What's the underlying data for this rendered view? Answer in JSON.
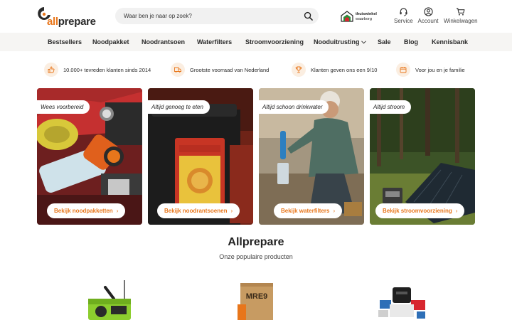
{
  "brand": {
    "name_prefix": "all",
    "name_suffix": "prepare",
    "accent": "#e8761b",
    "logo_icon": "allprepare-logo-icon"
  },
  "search": {
    "placeholder": "Waar ben je naar op zoek?",
    "icon": "search-icon"
  },
  "trust_badge": {
    "line1": "thuiswinkel",
    "line2": "waarborg",
    "icon": "thuiswinkel-house-icon"
  },
  "header_actions": [
    {
      "label": "Service",
      "icon": "headset-icon"
    },
    {
      "label": "Account",
      "icon": "user-icon"
    },
    {
      "label": "Winkelwagen",
      "icon": "cart-icon"
    }
  ],
  "nav": [
    {
      "label": "Bestsellers"
    },
    {
      "label": "Noodpakket"
    },
    {
      "label": "Noodrantsoen"
    },
    {
      "label": "Waterfilters"
    },
    {
      "label": "Stroomvoorziening"
    },
    {
      "label": "Nooduitrusting",
      "has_dropdown": true,
      "icon": "chevron-down-icon"
    },
    {
      "label": "Sale"
    },
    {
      "label": "Blog"
    },
    {
      "label": "Kennisbank"
    }
  ],
  "usps": [
    {
      "text": "10.000+ tevreden klanten sinds 2014",
      "icon": "thumbs-up-icon"
    },
    {
      "text": "Grootste voorraad van Nederland",
      "icon": "truck-icon"
    },
    {
      "text": "Klanten geven ons een 9/10",
      "icon": "trophy-icon"
    },
    {
      "text": "Voor jou en je familie",
      "icon": "calendar-icon"
    }
  ],
  "categories": [
    {
      "tag": "Wees voorbereid",
      "cta": "Bekijk noodpakketten",
      "arrow": "›"
    },
    {
      "tag": "Altijd genoeg te eten",
      "cta": "Bekijk noodrantsoenen",
      "arrow": "›"
    },
    {
      "tag": "Altijd schoon drinkwater",
      "cta": "Bekijk waterfilters",
      "arrow": "›"
    },
    {
      "tag": "Altijd stroom",
      "cta": "Bekijk stroomvoorziening",
      "arrow": "›"
    }
  ],
  "section": {
    "title": "Allprepare",
    "subtitle": "Onze populaire producten"
  },
  "products": [
    {
      "name": "crank-radio-product-image"
    },
    {
      "name": "mre-box-product-image",
      "box_text": "MRE9"
    },
    {
      "name": "emergency-kit-product-image"
    }
  ]
}
